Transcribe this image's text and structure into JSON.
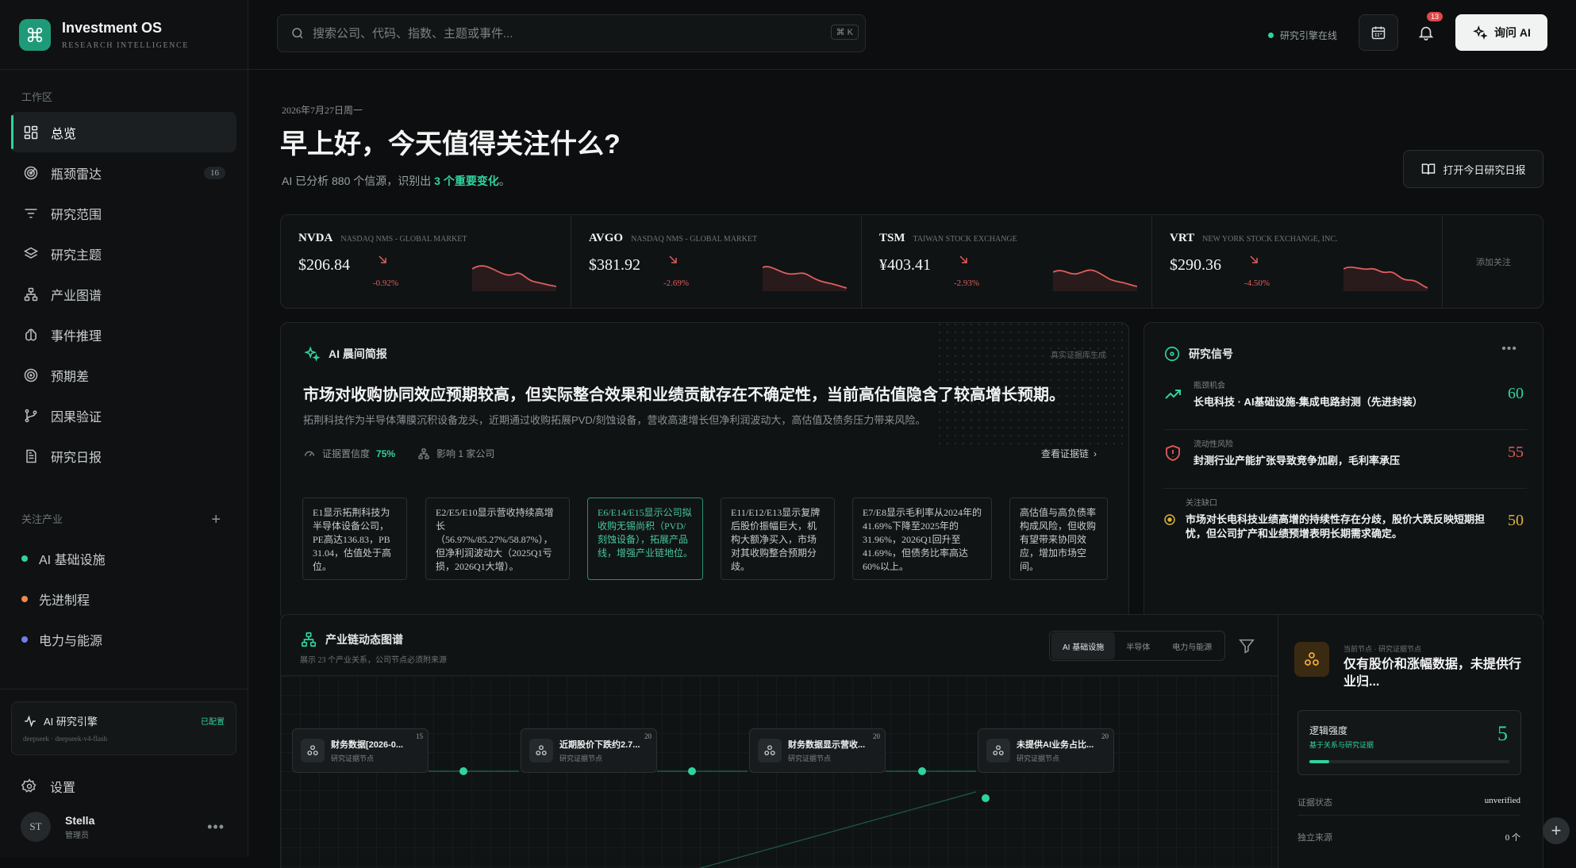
{
  "brand": {
    "name": "Investment OS",
    "sub": "RESEARCH INTELLIGENCE"
  },
  "sidebar": {
    "section_workspace": "工作区",
    "items": [
      {
        "label": "总览",
        "icon": "grid-icon",
        "active": true
      },
      {
        "label": "瓶颈雷达",
        "icon": "radar-icon",
        "badge": "16"
      },
      {
        "label": "研究范围",
        "icon": "filter-lines-icon"
      },
      {
        "label": "研究主题",
        "icon": "layers-icon"
      },
      {
        "label": "产业图谱",
        "icon": "network-icon"
      },
      {
        "label": "事件推理",
        "icon": "brain-icon"
      },
      {
        "label": "预期差",
        "icon": "target-icon"
      },
      {
        "label": "因果验证",
        "icon": "branch-icon"
      },
      {
        "label": "研究日报",
        "icon": "document-icon"
      }
    ],
    "section_industry": "关注产业",
    "industries": [
      {
        "label": "AI 基础设施",
        "color": "#2fd39f"
      },
      {
        "label": "先进制程",
        "color": "#f08a4b"
      },
      {
        "label": "电力与能源",
        "color": "#6f7ff0"
      }
    ],
    "engine": {
      "title": "AI 研究引擎",
      "status": "已配置",
      "model": "deepseek · deepseek-v4-flash"
    },
    "settings": "设置",
    "user": {
      "initials": "ST",
      "name": "Stella",
      "role": "管理员"
    }
  },
  "topbar": {
    "search_placeholder": "搜索公司、代码、指数、主题或事件...",
    "shortcut": "⌘ K",
    "engine_status": "研究引擎在线",
    "notif_count": "13",
    "ask_ai": "询问 AI"
  },
  "header": {
    "date": "2026年7月27日周一",
    "title": "早上好，今天值得关注什么?",
    "sub_pre": "AI 已分析 880 个信源，识别出 ",
    "sub_hl": "3 个重要变化",
    "sub_post": "。",
    "open_report": "打开今日研究日报"
  },
  "tickers": [
    {
      "sym": "NVDA",
      "exch": "NASDAQ NMS - GLOBAL MARKET",
      "price": "$206.84",
      "change": "-0.92%"
    },
    {
      "sym": "AVGO",
      "exch": "NASDAQ NMS - GLOBAL MARKET",
      "price": "$381.92",
      "change": "-2.69%"
    },
    {
      "sym": "TSM",
      "exch": "TAIWAN STOCK EXCHANGE",
      "price": "¥403.41",
      "change": "-2.93%"
    },
    {
      "sym": "VRT",
      "exch": "NEW YORK STOCK EXCHANGE, INC.",
      "price": "$290.36",
      "change": "-4.50%"
    }
  ],
  "add_watch": "添加关注",
  "brief": {
    "title": "AI 晨间简报",
    "tag": "真实证据库生成",
    "headline": "市场对收购协同效应预期较高，但实际整合效果和业绩贡献存在不确定性，当前高估值隐含了较高增长预期。",
    "desc": "拓荆科技作为半导体薄膜沉积设备龙头，近期通过收购拓展PVD/刻蚀设备，营收高速增长但净利润波动大，高估值及债务压力带来风险。",
    "confidence_label": "证据置信度",
    "confidence": "75%",
    "impact": "影响 1 家公司",
    "view_chain": "查看证据链",
    "evidence": [
      "E1显示拓荆科技为半导体设备公司，PE高达136.83，PB 31.04，估值处于高位。",
      "E2/E5/E10显示营收持续高增长（56.97%/85.27%/58.87%），但净利润波动大（2025Q1亏损，2026Q1大增）。",
      "E6/E14/E15显示公司拟收购无锡尚积（PVD/刻蚀设备），拓展产品线，增强产业链地位。",
      "E11/E12/E13显示复牌后股价振幅巨大，机构大额净买入，市场对其收购整合预期分歧。",
      "E7/E8显示毛利率从2024年的41.69%下降至2025年的31.96%，2026Q1回升至41.69%，但债务比率高达60%以上。",
      "高估值与高负债率构成风险，但收购有望带来协同效应，增加市场空间。"
    ]
  },
  "signals": {
    "title": "研究信号",
    "items": [
      {
        "kind": "瓶颈机会",
        "text": "长电科技 · AI基础设施-集成电路封测（先进封装）",
        "score": "60",
        "color": "#2fd39f"
      },
      {
        "kind": "流动性风险",
        "text": "封测行业产能扩张导致竞争加剧，毛利率承压",
        "score": "55",
        "color": "#e05d5d"
      },
      {
        "kind": "关注缺口",
        "text": "市场对长电科技业绩高增的持续性存在分歧，股价大跌反映短期担忧，但公司扩产和业绩预增表明长期需求确定。",
        "score": "50",
        "color": "#e0b23a"
      }
    ]
  },
  "chain": {
    "title": "产业链动态图谱",
    "sub": "展示 23 个产业关系，公司节点必须附来源",
    "tabs": [
      "AI 基础设施",
      "半导体",
      "电力与能源"
    ],
    "nodes": [
      {
        "title": "财务数据[2026-0...",
        "sub": "研究证据节点",
        "n": "15"
      },
      {
        "title": "近期股价下跌约2.7...",
        "sub": "研究证据节点",
        "n": "20"
      },
      {
        "title": "财务数据显示营收...",
        "sub": "研究证据节点",
        "n": "20"
      },
      {
        "title": "未提供AI业务占比...",
        "sub": "研究证据节点",
        "n": "20"
      }
    ]
  },
  "detail": {
    "kicker": "当前节点 · 研究证据节点",
    "title": "仅有股价和涨幅数据，未提供行业归...",
    "strength_label": "逻辑强度",
    "strength_sub": "基于关系与研究证据",
    "strength": "5",
    "strength_frac": 0.1,
    "status_label": "证据状态",
    "status": "unverified",
    "source_label": "独立来源",
    "source": "0 个"
  }
}
